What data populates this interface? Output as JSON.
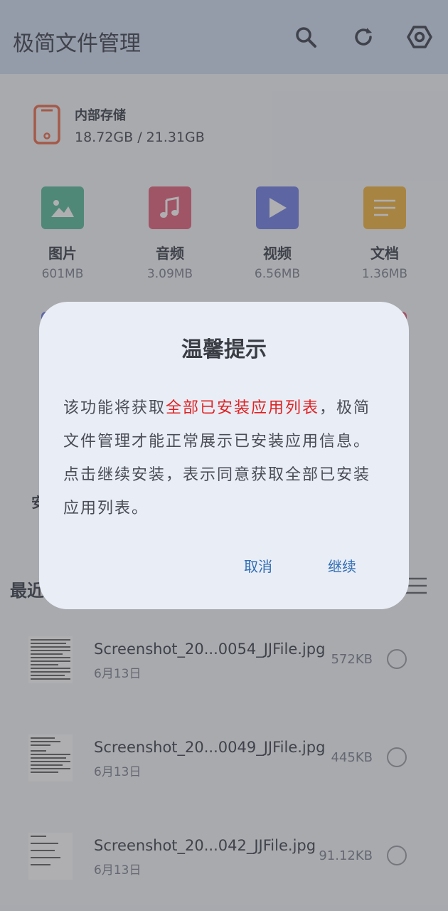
{
  "app": {
    "title": "极简文件管理"
  },
  "storage": {
    "label": "内部存储",
    "size": "18.72GB / 21.31GB"
  },
  "categories": [
    {
      "name": "图片",
      "size": "601MB",
      "color": "#41b08a",
      "icon": "image-icon"
    },
    {
      "name": "音频",
      "size": "3.09MB",
      "color": "#e04a6b",
      "icon": "music-note-icon"
    },
    {
      "name": "视频",
      "size": "6.56MB",
      "color": "#5a6ce0",
      "icon": "play-icon"
    },
    {
      "name": "文档",
      "size": "1.36MB",
      "color": "#f0a820",
      "icon": "document-lines-icon"
    }
  ],
  "section_fragment": "安",
  "recent": {
    "title": "最近"
  },
  "files": [
    {
      "name": "Screenshot_20...0054_JJFile.jpg",
      "date": "6月13日",
      "size": "572KB"
    },
    {
      "name": "Screenshot_20...0049_JJFile.jpg",
      "date": "6月13日",
      "size": "445KB"
    },
    {
      "name": "Screenshot_20...042_JJFile.jpg",
      "date": "6月13日",
      "size": "91.12KB"
    }
  ],
  "dialog": {
    "title": "温馨提示",
    "body_before": "该功能将获取",
    "body_highlight": "全部已安装应用列表",
    "body_after": "，极简文件管理才能正常展示已安装应用信息。点击继续安装，表示同意获取全部已安装应用列表。",
    "cancel_label": "取消",
    "continue_label": "继续"
  },
  "colors": {
    "topbar": "#c8d6ef",
    "highlight": "#e02222",
    "dialog_button": "#2f6db3",
    "storage_icon": "#e8552f"
  }
}
